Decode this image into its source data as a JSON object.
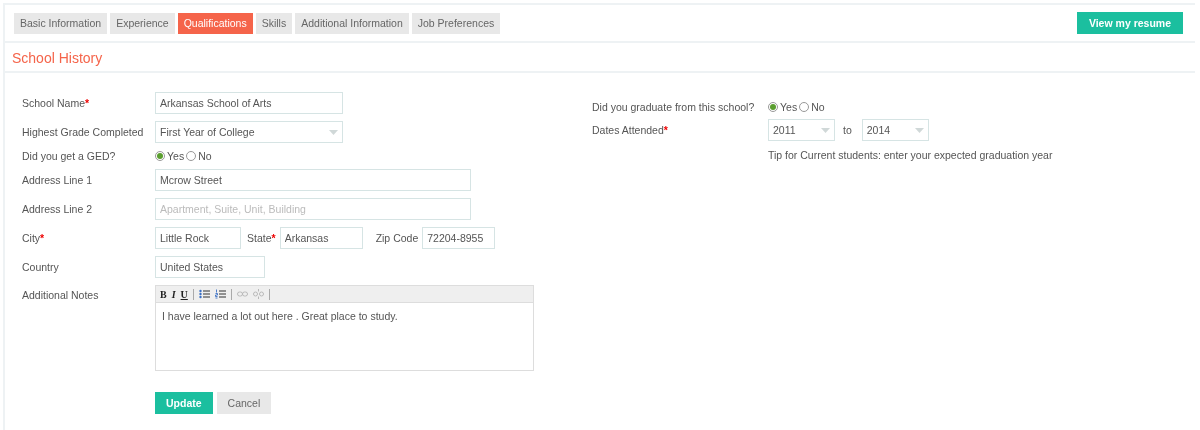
{
  "tabs": [
    {
      "label": "Basic Information",
      "selected": false
    },
    {
      "label": "Experience",
      "selected": false
    },
    {
      "label": "Qualifications",
      "selected": true
    },
    {
      "label": "Skills",
      "selected": false
    },
    {
      "label": "Additional Information",
      "selected": false
    },
    {
      "label": "Job Preferences",
      "selected": false
    }
  ],
  "view_resume_button": "View my resume",
  "section_title": "School History",
  "required_marker": "*",
  "left_fields": [
    {
      "kind": "text",
      "label": "School Name",
      "required": true,
      "value": "Arkansas School of Arts"
    },
    {
      "kind": "select",
      "label": "Highest Grade Completed",
      "required": false,
      "value": "First Year of College"
    },
    {
      "kind": "radio",
      "label": "Did you get a GED?",
      "required": false,
      "options": [
        {
          "label": "Yes",
          "selected": true
        },
        {
          "label": "No",
          "selected": false
        }
      ]
    },
    {
      "kind": "wide_text",
      "label": "Address Line 1",
      "required": false,
      "value": "Mcrow Street"
    },
    {
      "kind": "wide_text",
      "label": "Address Line 2",
      "required": false,
      "placeholder": "Apartment, Suite, Unit, Building"
    },
    {
      "kind": "city_state_zip",
      "label": "City",
      "required": true,
      "value": "Little Rock",
      "state": {
        "label": "State",
        "required": true,
        "value": "Arkansas"
      },
      "zip": {
        "label": "Zip Code",
        "required": false,
        "value": "72204-8955"
      }
    },
    {
      "kind": "short_text",
      "label": "Country",
      "required": false,
      "value": "United States"
    },
    {
      "kind": "notes",
      "label": "Additional Notes",
      "required": false,
      "value": "I have learned a lot out here . Great place to study.",
      "toolbar": [
        {
          "kind": "bold",
          "text": "B",
          "disabled": false
        },
        {
          "kind": "italic",
          "text": "I",
          "disabled": false
        },
        {
          "kind": "underline",
          "text": "U",
          "disabled": false
        },
        {
          "kind": "bullet_list",
          "disabled": false
        },
        {
          "kind": "numbered_list",
          "disabled": false
        },
        {
          "kind": "link",
          "disabled": true
        },
        {
          "kind": "unlink",
          "disabled": true
        }
      ]
    }
  ],
  "right_fields": [
    {
      "kind": "radio",
      "label": "Did you graduate from this school?",
      "required": false,
      "options": [
        {
          "label": "Yes",
          "selected": true
        },
        {
          "label": "No",
          "selected": false
        }
      ]
    },
    {
      "kind": "date_range",
      "label": "Dates Attended",
      "required": true,
      "from": "2011",
      "separator": "to",
      "to": "2014",
      "tip": "Tip for Current students: enter your expected graduation year"
    }
  ],
  "buttons": [
    {
      "kind": "primary",
      "label": "Update"
    },
    {
      "kind": "secondary",
      "label": "Cancel"
    }
  ]
}
